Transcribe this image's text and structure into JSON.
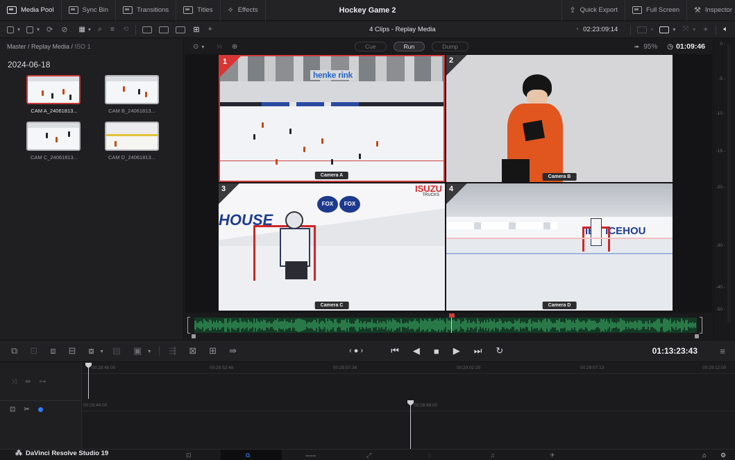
{
  "topbar": {
    "media_pool": "Media Pool",
    "sync_bin": "Sync Bin",
    "transitions": "Transitions",
    "titles": "Titles",
    "effects": "Effects",
    "project_title": "Hockey Game 2",
    "quick_export": "Quick Export",
    "full_screen": "Full Screen",
    "inspector": "Inspector"
  },
  "toolbar": {
    "clips_label": "4 Clips - Replay Media",
    "timecode": "02:23:09:14"
  },
  "media_pool": {
    "breadcrumb": "Master / Replay Media /",
    "breadcrumb_last": "ISO 1",
    "date_group": "2024-06-18",
    "clips": [
      {
        "name": "CAM A_24061813..."
      },
      {
        "name": "CAM B_24061813..."
      },
      {
        "name": "CAM C_24061813..."
      },
      {
        "name": "CAM D_24061813..."
      }
    ]
  },
  "viewer": {
    "cue": "Cue",
    "run": "Run",
    "dump": "Dump",
    "zoom": "95%",
    "duration": "01:09:46",
    "cameras": [
      {
        "num": "1",
        "label": "Camera A",
        "sign": "henke rink"
      },
      {
        "num": "2",
        "label": "Camera B"
      },
      {
        "num": "3",
        "label": "Camera C",
        "sign": "HOUSE",
        "sponsor": "ISUZU",
        "sponsor_sub": "TRUCKS",
        "badge": "FOX"
      },
      {
        "num": "4",
        "label": "Camera D",
        "sign": "IEN ICEHOU"
      }
    ]
  },
  "meter": {
    "ticks": [
      "0 -",
      "-5 -",
      "-10 -",
      "-15 -",
      "-20 -",
      "-30 -",
      "-40 -",
      "-50 -"
    ]
  },
  "controls": {
    "timecode": "01:13:23:43"
  },
  "timeline": {
    "upper_ticks": [
      "00:28:48:00",
      "00:28:52:48",
      "00:28:57:36",
      "00:29:02:25",
      "00:29:07:13",
      "00:29:12:00"
    ],
    "lower_ticks": [
      "00:28:44:00",
      "00:28:48:00"
    ]
  },
  "footer": {
    "brand": "DaVinci Resolve Studio 19"
  },
  "colors": {
    "selection_red": "#c93a3a",
    "waveform_green": "#3fb86a",
    "timeline_blue": "#2f7df6"
  }
}
